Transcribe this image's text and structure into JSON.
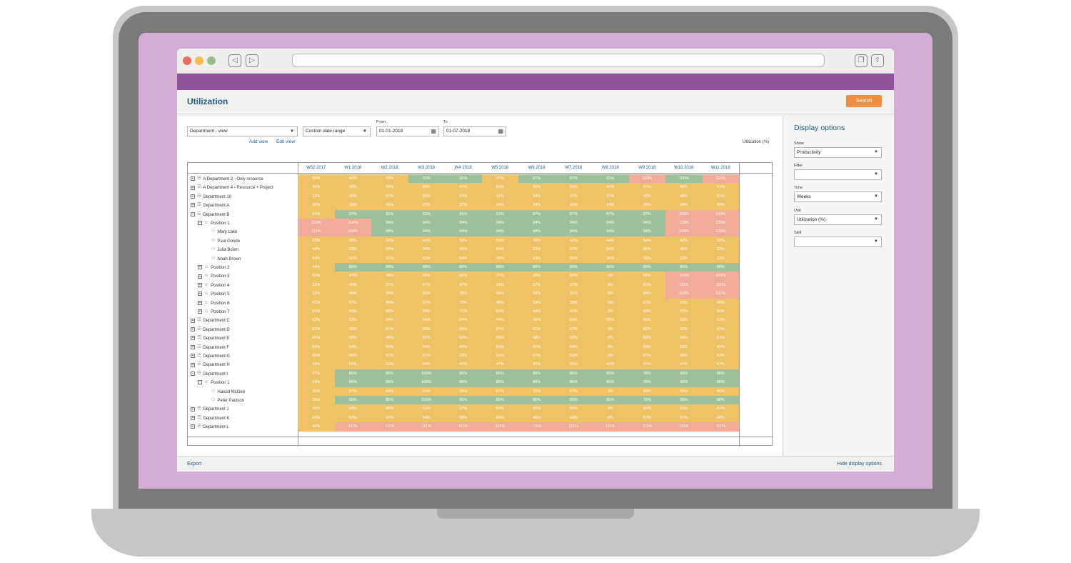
{
  "app": {
    "title": "Utilization",
    "search_label": "Search",
    "export_label": "Export",
    "hide_options_label": "Hide display options"
  },
  "controls": {
    "view_select": "Department - view",
    "date_range_select": "Custom date range",
    "from_label": "From",
    "from_value": "01-01-2018",
    "to_label": "To",
    "to_value": "01-07-2018",
    "add_view": "Add view",
    "edit_view": "Edit view",
    "unit_caption": "Utilization (%)"
  },
  "side": {
    "title": "Display options",
    "fields": [
      {
        "label": "Show",
        "value": "Productivity"
      },
      {
        "label": "Filter",
        "value": ""
      },
      {
        "label": "Time",
        "value": "Weeks"
      },
      {
        "label": "Unit",
        "value": "Utilization (%)"
      },
      {
        "label": "Skill",
        "value": ""
      }
    ]
  },
  "colors": {
    "orange": "#f0c266",
    "green": "#9dc09b",
    "red": "#f2aa99",
    "accent": "#245b8a",
    "brand": "#8e549d"
  },
  "columns": [
    "W52 2017",
    "W1 2018",
    "W2 2018",
    "W3 2018",
    "W4 2018",
    "W5 2018",
    "W6 2018",
    "W7 2018",
    "W8 2018",
    "W9 2018",
    "W10 2018",
    "W11 2018"
  ],
  "rows": [
    {
      "label": "A Department 2 - Only resource",
      "level": 0,
      "type": "dept",
      "toggle": "+",
      "values": [
        "38%",
        "40%",
        "43%",
        "91%",
        "91%",
        "37%",
        "87%",
        "87%",
        "91%",
        "103%",
        "100%",
        "111%"
      ],
      "colors": [
        "o",
        "o",
        "o",
        "g",
        "g",
        "o",
        "g",
        "g",
        "g",
        "r",
        "g",
        "r"
      ]
    },
    {
      "label": "A Department 4 - Resource + Project",
      "level": 0,
      "type": "dept",
      "toggle": "+",
      "values": [
        "38%",
        "36%",
        "43%",
        "66%",
        "47%",
        "66%",
        "56%",
        "55%",
        "47%",
        "47%",
        "40%",
        "41%"
      ],
      "colors": [
        "o",
        "o",
        "o",
        "o",
        "o",
        "o",
        "o",
        "o",
        "o",
        "o",
        "o",
        "o"
      ]
    },
    {
      "label": "Department 10",
      "level": 0,
      "type": "dept",
      "toggle": "+",
      "values": [
        "23%",
        "30%",
        "57%",
        "55%",
        "52%",
        "42%",
        "34%",
        "37%",
        "37%",
        "43%",
        "48%",
        "51%"
      ],
      "colors": [
        "o",
        "o",
        "o",
        "o",
        "o",
        "o",
        "o",
        "o",
        "o",
        "o",
        "o",
        "o"
      ]
    },
    {
      "label": "Department A",
      "level": 0,
      "type": "dept",
      "toggle": "+",
      "values": [
        "36%",
        "36%",
        "40%",
        "37%",
        "37%",
        "34%",
        "34%",
        "34%",
        "34%",
        "34%",
        "34%",
        "43%"
      ],
      "colors": [
        "o",
        "o",
        "o",
        "o",
        "o",
        "o",
        "o",
        "o",
        "o",
        "o",
        "o",
        "o"
      ]
    },
    {
      "label": "Department B",
      "level": 0,
      "type": "dept",
      "toggle": "-",
      "values": [
        "91%",
        "97%",
        "91%",
        "91%",
        "91%",
        "91%",
        "87%",
        "87%",
        "87%",
        "87%",
        "103%",
        "103%"
      ],
      "colors": [
        "o",
        "g",
        "g",
        "g",
        "g",
        "g",
        "g",
        "g",
        "g",
        "g",
        "r",
        "r"
      ]
    },
    {
      "label": "Position 1",
      "level": 1,
      "type": "pos",
      "toggle": "-",
      "values": [
        "110%",
        "116%",
        "94%",
        "94%",
        "94%",
        "94%",
        "94%",
        "94%",
        "94%",
        "94%",
        "129%",
        "129%"
      ],
      "colors": [
        "r",
        "r",
        "g",
        "g",
        "g",
        "g",
        "g",
        "g",
        "g",
        "g",
        "r",
        "r"
      ]
    },
    {
      "label": "Mary Lake",
      "level": 2,
      "type": "person",
      "toggle": "",
      "values": [
        "111%",
        "116%",
        "94%",
        "94%",
        "94%",
        "94%",
        "94%",
        "94%",
        "94%",
        "94%",
        "129%",
        "129%"
      ],
      "colors": [
        "r",
        "r",
        "g",
        "g",
        "g",
        "g",
        "g",
        "g",
        "g",
        "g",
        "r",
        "r"
      ]
    },
    {
      "label": "Paul Goode",
      "level": 2,
      "type": "person",
      "toggle": "",
      "values": [
        "23%",
        "45%",
        "34%",
        "43%",
        "58%",
        "55%",
        "39%",
        "42%",
        "44%",
        "54%",
        "42%",
        "23%"
      ],
      "colors": [
        "o",
        "o",
        "o",
        "o",
        "o",
        "o",
        "o",
        "o",
        "o",
        "o",
        "o",
        "o"
      ]
    },
    {
      "label": "Julia Boom",
      "level": 2,
      "type": "person",
      "toggle": "",
      "values": [
        "44%",
        "23%",
        "34%",
        "34%",
        "43%",
        "64%",
        "53%",
        "57%",
        "54%",
        "56%",
        "45%",
        "23%"
      ],
      "colors": [
        "o",
        "o",
        "o",
        "o",
        "o",
        "o",
        "o",
        "o",
        "o",
        "o",
        "o",
        "o"
      ]
    },
    {
      "label": "Noah Brown",
      "level": 2,
      "type": "person",
      "toggle": "",
      "values": [
        "44%",
        "52%",
        "41%",
        "42%",
        "54%",
        "36%",
        "53%",
        "35%",
        "36%",
        "43%",
        "23%",
        "12%"
      ],
      "colors": [
        "o",
        "o",
        "o",
        "o",
        "o",
        "o",
        "o",
        "o",
        "o",
        "o",
        "o",
        "o"
      ]
    },
    {
      "label": "Position 2",
      "level": 1,
      "type": "pos",
      "toggle": "+",
      "values": [
        "44%",
        "80%",
        "88%",
        "88%",
        "88%",
        "88%",
        "80%",
        "80%",
        "80%",
        "80%",
        "80%",
        "80%"
      ],
      "colors": [
        "o",
        "g",
        "g",
        "g",
        "g",
        "g",
        "g",
        "g",
        "g",
        "g",
        "g",
        "g"
      ]
    },
    {
      "label": "Position 3",
      "level": 1,
      "type": "pos",
      "toggle": "+",
      "values": [
        "42%",
        "47%",
        "38%",
        "56%",
        "52%",
        "37%",
        "56%",
        "35%",
        "0%",
        "68%",
        "103%",
        "103%"
      ],
      "colors": [
        "o",
        "o",
        "o",
        "o",
        "o",
        "o",
        "o",
        "o",
        "o",
        "o",
        "r",
        "r"
      ]
    },
    {
      "label": "Position 4",
      "level": 1,
      "type": "pos",
      "toggle": "+",
      "values": [
        "23%",
        "46%",
        "37%",
        "67%",
        "47%",
        "31%",
        "57%",
        "37%",
        "0%",
        "62%",
        "111%",
        "111%"
      ],
      "colors": [
        "o",
        "o",
        "o",
        "o",
        "o",
        "o",
        "o",
        "o",
        "o",
        "o",
        "r",
        "r"
      ]
    },
    {
      "label": "Position 5",
      "level": 1,
      "type": "pos",
      "toggle": "+",
      "values": [
        "33%",
        "46%",
        "35%",
        "55%",
        "78%",
        "46%",
        "59%",
        "31%",
        "0%",
        "64%",
        "103%",
        "101%"
      ],
      "colors": [
        "o",
        "o",
        "o",
        "o",
        "o",
        "o",
        "o",
        "o",
        "o",
        "o",
        "r",
        "r"
      ]
    },
    {
      "label": "Position 6",
      "level": 1,
      "type": "pos",
      "toggle": "+",
      "values": [
        "41%",
        "47%",
        "46%",
        "57%",
        "72%",
        "48%",
        "53%",
        "38%",
        "0%",
        "67%",
        "53%",
        "56%"
      ],
      "colors": [
        "o",
        "o",
        "o",
        "o",
        "o",
        "o",
        "o",
        "o",
        "o",
        "o",
        "o",
        "o"
      ]
    },
    {
      "label": "Position 7",
      "level": 1,
      "type": "pos",
      "toggle": "+",
      "values": [
        "51%",
        "43%",
        "68%",
        "59%",
        "71%",
        "63%",
        "54%",
        "41%",
        "0%",
        "63%",
        "57%",
        "60%"
      ],
      "colors": [
        "o",
        "o",
        "o",
        "o",
        "o",
        "o",
        "o",
        "o",
        "o",
        "o",
        "o",
        "o"
      ]
    },
    {
      "label": "Department C",
      "level": 0,
      "type": "dept",
      "toggle": "+",
      "values": [
        "63%",
        "63%",
        "64%",
        "64%",
        "64%",
        "64%",
        "66%",
        "66%",
        "66%",
        "66%",
        "63%",
        "63%"
      ],
      "colors": [
        "o",
        "o",
        "o",
        "o",
        "o",
        "o",
        "o",
        "o",
        "o",
        "o",
        "o",
        "o"
      ]
    },
    {
      "label": "Department D",
      "level": 0,
      "type": "dept",
      "toggle": "+",
      "values": [
        "51%",
        "36%",
        "67%",
        "68%",
        "68%",
        "57%",
        "61%",
        "57%",
        "0%",
        "61%",
        "62%",
        "62%"
      ],
      "colors": [
        "o",
        "o",
        "o",
        "o",
        "o",
        "o",
        "o",
        "o",
        "o",
        "o",
        "o",
        "o"
      ]
    },
    {
      "label": "Department E",
      "level": 0,
      "type": "dept",
      "toggle": "+",
      "values": [
        "41%",
        "63%",
        "46%",
        "62%",
        "62%",
        "58%",
        "68%",
        "62%",
        "0%",
        "60%",
        "54%",
        "61%"
      ],
      "colors": [
        "o",
        "o",
        "o",
        "o",
        "o",
        "o",
        "o",
        "o",
        "o",
        "o",
        "o",
        "o"
      ]
    },
    {
      "label": "Department F",
      "level": 0,
      "type": "dept",
      "toggle": "+",
      "values": [
        "52%",
        "64%",
        "59%",
        "54%",
        "49%",
        "56%",
        "61%",
        "64%",
        "0%",
        "60%",
        "51%",
        "42%"
      ],
      "colors": [
        "o",
        "o",
        "o",
        "o",
        "o",
        "o",
        "o",
        "o",
        "o",
        "o",
        "o",
        "o"
      ]
    },
    {
      "label": "Department G",
      "level": 0,
      "type": "dept",
      "toggle": "+",
      "values": [
        "45%",
        "68%",
        "57%",
        "67%",
        "23%",
        "51%",
        "67%",
        "62%",
        "0%",
        "67%",
        "58%",
        "43%"
      ],
      "colors": [
        "o",
        "o",
        "o",
        "o",
        "o",
        "o",
        "o",
        "o",
        "o",
        "o",
        "o",
        "o"
      ]
    },
    {
      "label": "Department H",
      "level": 0,
      "type": "dept",
      "toggle": "+",
      "values": [
        "43%",
        "51%",
        "51%",
        "64%",
        "47%",
        "47%",
        "47%",
        "56%",
        "47%",
        "47%",
        "47%",
        "47%"
      ],
      "colors": [
        "o",
        "o",
        "o",
        "o",
        "o",
        "o",
        "o",
        "o",
        "o",
        "o",
        "o",
        "o"
      ]
    },
    {
      "label": "Department I",
      "level": 0,
      "type": "dept",
      "toggle": "-",
      "values": [
        "47%",
        "85%",
        "85%",
        "100%",
        "85%",
        "85%",
        "85%",
        "85%",
        "85%",
        "78%",
        "98%",
        "98%"
      ],
      "colors": [
        "o",
        "g",
        "g",
        "g",
        "g",
        "g",
        "g",
        "g",
        "g",
        "g",
        "g",
        "g"
      ]
    },
    {
      "label": "Position 1",
      "level": 1,
      "type": "pos",
      "toggle": "-",
      "values": [
        "34%",
        "85%",
        "85%",
        "100%",
        "85%",
        "85%",
        "85%",
        "85%",
        "85%",
        "78%",
        "98%",
        "98%"
      ],
      "colors": [
        "o",
        "g",
        "g",
        "g",
        "g",
        "g",
        "g",
        "g",
        "g",
        "g",
        "g",
        "g"
      ]
    },
    {
      "label": "Harold McGee",
      "level": 2,
      "type": "person",
      "toggle": "",
      "values": [
        "35%",
        "57%",
        "54%",
        "53%",
        "29%",
        "67%",
        "72%",
        "67%",
        "0%",
        "69%",
        "56%",
        "46%"
      ],
      "colors": [
        "o",
        "o",
        "o",
        "o",
        "o",
        "o",
        "o",
        "o",
        "o",
        "o",
        "o",
        "o"
      ]
    },
    {
      "label": "Peter Paulson",
      "level": 2,
      "type": "person",
      "toggle": "",
      "values": [
        "36%",
        "85%",
        "85%",
        "100%",
        "85%",
        "85%",
        "85%",
        "85%",
        "85%",
        "78%",
        "98%",
        "98%"
      ],
      "colors": [
        "o",
        "g",
        "g",
        "g",
        "g",
        "g",
        "g",
        "g",
        "g",
        "g",
        "g",
        "g"
      ]
    },
    {
      "label": "Department J",
      "level": 0,
      "type": "dept",
      "toggle": "+",
      "values": [
        "38%",
        "54%",
        "49%",
        "52%",
        "27%",
        "61%",
        "42%",
        "69%",
        "0%",
        "62%",
        "51%",
        "41%"
      ],
      "colors": [
        "o",
        "o",
        "o",
        "o",
        "o",
        "o",
        "o",
        "o",
        "o",
        "o",
        "o",
        "o"
      ]
    },
    {
      "label": "Department K",
      "level": 0,
      "type": "dept",
      "toggle": "+",
      "values": [
        "43%",
        "53%",
        "47%",
        "54%",
        "58%",
        "64%",
        "46%",
        "64%",
        "0%",
        "67%",
        "57%",
        "48%"
      ],
      "colors": [
        "o",
        "o",
        "o",
        "o",
        "o",
        "o",
        "o",
        "o",
        "o",
        "o",
        "o",
        "o"
      ]
    },
    {
      "label": "Department L",
      "level": 0,
      "type": "dept",
      "toggle": "+",
      "values": [
        "48%",
        "111%",
        "111%",
        "111%",
        "111%",
        "111%",
        "111%",
        "111%",
        "111%",
        "111%",
        "111%",
        "111%"
      ],
      "colors": [
        "o",
        "r",
        "r",
        "r",
        "r",
        "r",
        "r",
        "r",
        "r",
        "r",
        "r",
        "r"
      ]
    }
  ]
}
